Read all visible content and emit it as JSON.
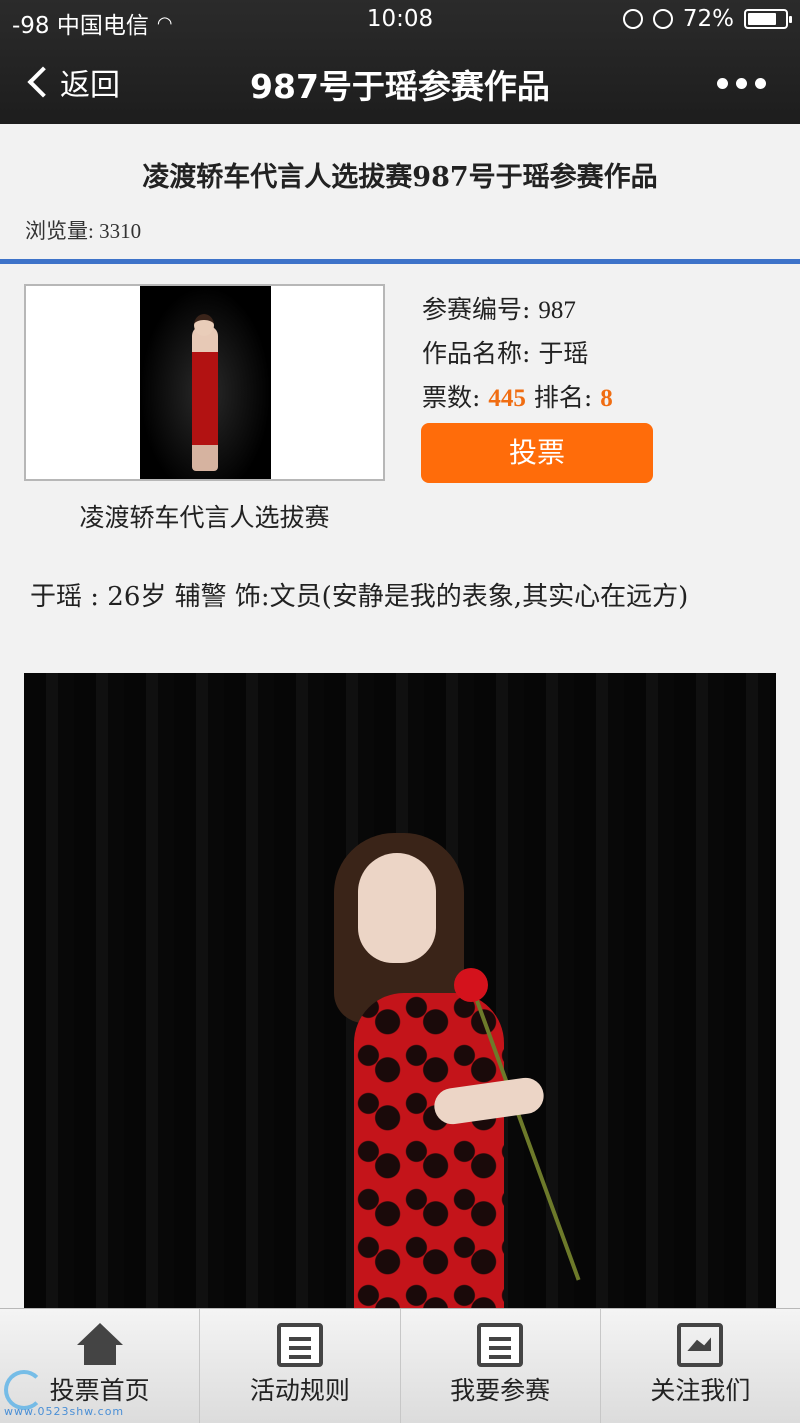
{
  "status_bar": {
    "carrier": "-98 中国电信",
    "time": "10:08",
    "battery": "72%",
    "battery_level": 0.72
  },
  "nav": {
    "back_label": "返回",
    "title": "987号于瑶参赛作品"
  },
  "page": {
    "heading": "凌渡轿车代言人选拔赛987号于瑶参赛作品",
    "views_label": "浏览量:",
    "views_count": "3310"
  },
  "entry": {
    "number_label": "参赛编号:",
    "number": "987",
    "name_label": "作品名称:",
    "name": "于瑶",
    "votes_label": "票数:",
    "votes": "445",
    "rank_label": "排名:",
    "rank": "8",
    "vote_button": "投票",
    "contest_name": "凌渡轿车代言人选拔赛",
    "description": "于瑶 : 26岁 辅警 饰:文员(安静是我的表象,其实心在远方)"
  },
  "tabbar": {
    "items": [
      {
        "label": "投票首页",
        "icon": "home-icon"
      },
      {
        "label": "活动规则",
        "icon": "document-icon"
      },
      {
        "label": "我要参赛",
        "icon": "edit-icon"
      },
      {
        "label": "关注我们",
        "icon": "photo-icon"
      }
    ]
  },
  "watermark": "www.0523shw.com",
  "colors": {
    "accent_orange": "#ff6c0a",
    "divider_blue": "#3e73c9",
    "nav_bg": "#1d1d1d"
  }
}
